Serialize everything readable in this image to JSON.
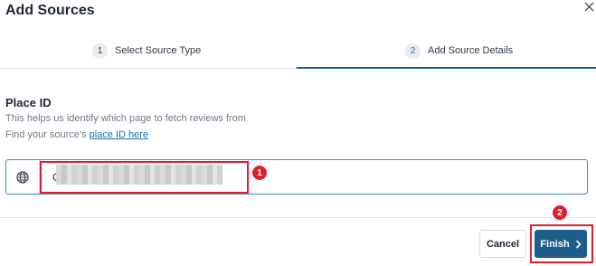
{
  "dialog": {
    "title": "Add Sources",
    "close_icon": "close-icon"
  },
  "stepper": {
    "steps": [
      {
        "number": "1",
        "label": "Select Source Type"
      },
      {
        "number": "2",
        "label": "Add Source Details"
      }
    ],
    "active_step": "2"
  },
  "form": {
    "section_title": "Place ID",
    "help_text": "This helps us identify which page to fetch reviews from",
    "find_text": "Find your source's ",
    "find_link": "place ID here",
    "input_icon": "globe-icon",
    "input_value": "Chl"
  },
  "annotations": {
    "marker_1": "1",
    "marker_2": "2",
    "color": "#e0202c"
  },
  "footer": {
    "cancel_label": "Cancel",
    "finish_label": "Finish",
    "finish_icon": "chevron-right-icon"
  },
  "colors": {
    "primary": "#1d5e8d",
    "input_border": "#3a8fc5",
    "link": "#1d6fa5"
  }
}
